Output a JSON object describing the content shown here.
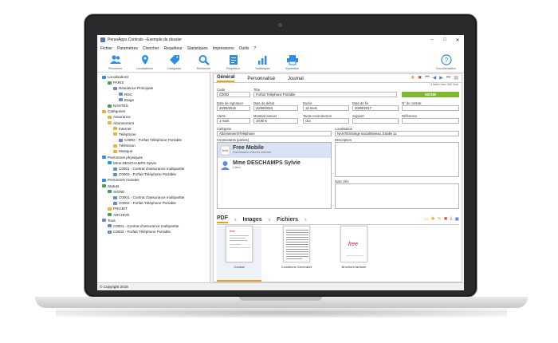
{
  "window": {
    "title": "PersoApps Contrats - Exemple de dossier",
    "controls": [
      "–",
      "□",
      "✕"
    ]
  },
  "menu": [
    "Fichier",
    "Paramètres",
    "Chercher",
    "Requêteur",
    "Statistiques",
    "Impressions",
    "Outils",
    "?"
  ],
  "toolbar": {
    "items": [
      {
        "label": "Personnes",
        "icon": "people-icon"
      },
      {
        "label": "Localisations",
        "icon": "location-pin-icon"
      },
      {
        "label": "Catégories",
        "icon": "tag-icon"
      },
      {
        "label": "Recherche",
        "icon": "search-icon"
      },
      {
        "label": "Requêteur",
        "icon": "report-icon"
      },
      {
        "label": "Statistiques",
        "icon": "chart-icon"
      },
      {
        "label": "Impression",
        "icon": "printer-icon"
      }
    ],
    "help": {
      "label": "Documentation",
      "icon": "help-icon"
    },
    "accent": "#2f8ee0"
  },
  "tree": [
    {
      "label": "Localisations",
      "indent": 0,
      "color": "#2f8ee0"
    },
    {
      "label": "PARIS",
      "indent": 1,
      "color": "#3ba35b"
    },
    {
      "label": "Résidence Principale",
      "indent": 2,
      "color": "#6a8ac4"
    },
    {
      "label": "RDC",
      "indent": 3,
      "color": "#6a8ac4"
    },
    {
      "label": "Etage",
      "indent": 3,
      "color": "#6a8ac4"
    },
    {
      "label": "NANTES",
      "indent": 1,
      "color": "#3ba35b"
    },
    {
      "label": "Catégories",
      "indent": 0,
      "color": "#e6b43a"
    },
    {
      "label": "Assurance",
      "indent": 1,
      "color": "#e6b43a"
    },
    {
      "label": "Abonnement",
      "indent": 1,
      "color": "#e6b43a"
    },
    {
      "label": "Internet",
      "indent": 2,
      "color": "#e6b43a"
    },
    {
      "label": "Téléphone",
      "indent": 2,
      "color": "#e6b43a"
    },
    {
      "label": "C0002 - Forfait Téléphone Portable",
      "indent": 3,
      "color": "#6a8ac4"
    },
    {
      "label": "Télévision",
      "indent": 2,
      "color": "#e6b43a"
    },
    {
      "label": "Musique",
      "indent": 2,
      "color": "#e6b43a"
    },
    {
      "label": "Personnes physiques",
      "indent": 0,
      "color": "#2f8ee0"
    },
    {
      "label": "Mme DESCHAMPS Sylvie",
      "indent": 1,
      "color": "#2f8ee0"
    },
    {
      "label": "C0001 - Contrat d'assurance multipartite",
      "indent": 2,
      "color": "#6a8ac4"
    },
    {
      "label": "C0002 - Forfait Téléphone Portable",
      "indent": 2,
      "color": "#6a8ac4"
    },
    {
      "label": "Personnes morales",
      "indent": 0,
      "color": "#2f8ee0"
    },
    {
      "label": "Statuts",
      "indent": 0,
      "color": "#3ba35b"
    },
    {
      "label": "SIGNE",
      "indent": 1,
      "color": "#3ba35b"
    },
    {
      "label": "C0001 - Contrat d'assurance multipartite",
      "indent": 2,
      "color": "#6a8ac4"
    },
    {
      "label": "C0002 - Forfait Téléphone Portable",
      "indent": 2,
      "color": "#6a8ac4"
    },
    {
      "label": "PROJET",
      "indent": 1,
      "color": "#e6b43a"
    },
    {
      "label": "ARCHIVE",
      "indent": 1,
      "color": "#3ba35b"
    },
    {
      "label": "Tous",
      "indent": 0,
      "color": "#6a8ac4"
    },
    {
      "label": "C0001 - Contrat d'assurance multipartite",
      "indent": 1,
      "color": "#6a8ac4"
    },
    {
      "label": "C0002 - Forfait Téléphone Portable",
      "indent": 1,
      "color": "#6a8ac4"
    }
  ],
  "tabs": [
    "Général",
    "Personnalisé",
    "Journal"
  ],
  "record_counter": "4 lettre bien 359 liste",
  "form": {
    "code_label": "Code",
    "code": "C0002",
    "titre_label": "Titre",
    "titre": "Forfait Téléphone Portable",
    "statut": "SIGNE",
    "signature_label": "Date de signature",
    "signature": "20/09/2016",
    "debut_label": "Date de début",
    "debut": "20/09/2016",
    "duree_label": "Durée",
    "duree": "12 mois",
    "fin_label": "Date de fin",
    "fin": "20/09/2017",
    "numero_label": "N° de contrat",
    "numero": "",
    "alerte_label": "Alerte",
    "alerte": "1 mois",
    "montant_label": "Montant annuel",
    "montant": "19,90 €",
    "tacite_label": "Tacite reconduction",
    "tacite": "Oui",
    "support_label": "Support",
    "support": "",
    "reference_label": "Référence",
    "reference": "",
    "categorie_label": "Catégorie",
    "categorie": "Abonnement\\Téléphone",
    "localisation_label": "Localisation",
    "localisation": "NANTES\\Siège social\\Niveau 1\\Salle 11",
    "contractants_label": "Contractants (parties)",
    "description_label": "Description",
    "notes_label": "Note clés"
  },
  "contractants": [
    {
      "name": "Free Mobile",
      "role": "Fournisseur d'Accès Internet"
    },
    {
      "name": "Mme DESCHAMPS Sylvie",
      "role": "Client"
    }
  ],
  "doc_tabs": [
    {
      "label": "PDF",
      "count": "3"
    },
    {
      "label": "Images",
      "count": "0"
    },
    {
      "label": "Fichiers",
      "count": "0"
    }
  ],
  "documents": [
    {
      "caption": "Contrat"
    },
    {
      "caption": "Conditions Générales"
    },
    {
      "caption": "Brochure tarifaire"
    }
  ],
  "status_text": "© Copyright 2016"
}
